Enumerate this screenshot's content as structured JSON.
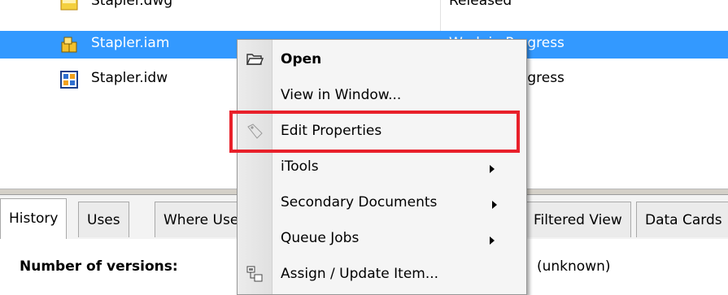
{
  "top_link": {
    "text": ""
  },
  "file_list": {
    "rows": [
      {
        "name": "Stapler.dwg",
        "state": "Released",
        "icon": "drawing-dwg-icon"
      },
      {
        "name": "Stapler.iam",
        "state": "Work in Progress",
        "icon": "assembly-iam-icon",
        "selected": true
      },
      {
        "name": "Stapler.idw",
        "state": "Work in Progress",
        "icon": "drawing-idw-icon"
      }
    ]
  },
  "context_menu": {
    "items": [
      {
        "label": "Open",
        "icon": "folder-open-icon",
        "bold": true
      },
      {
        "label": "View in Window..."
      },
      {
        "label": "Edit Properties",
        "icon": "tag-icon"
      },
      {
        "label": "iTools",
        "submenu": true
      },
      {
        "label": "Secondary Documents",
        "submenu": true
      },
      {
        "label": "Queue Jobs",
        "submenu": true
      },
      {
        "label": "Assign / Update Item...",
        "icon": "assign-item-icon"
      }
    ]
  },
  "tabs": [
    {
      "label": "History",
      "active": true
    },
    {
      "label": "Uses"
    },
    {
      "label": "Where Used"
    },
    {
      "label": "Filtered View"
    },
    {
      "label": "Data Cards"
    }
  ],
  "details": {
    "versions_label": "Number of versions:",
    "versions_value": "(unknown)"
  },
  "colors": {
    "selection": "#3399ff",
    "highlight_box": "#e8202a",
    "menu_bg": "#f5f5f5"
  }
}
